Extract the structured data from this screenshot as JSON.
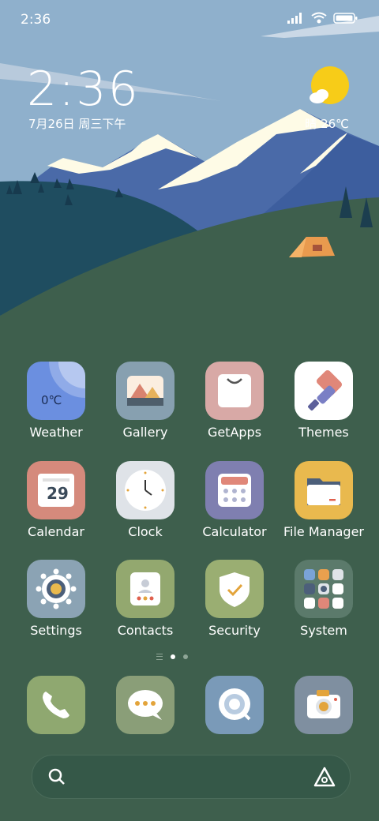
{
  "status_bar": {
    "time": "2:36"
  },
  "lockclock": {
    "time": "2:36",
    "date": "7月26日 周三下午",
    "weather": "晴 26℃"
  },
  "apps_row1": [
    {
      "label": "Weather",
      "icon_text": "0℃",
      "icon": "weather-icon",
      "color": "#6b8fe0"
    },
    {
      "label": "Gallery",
      "icon": "gallery-icon",
      "color": "#87a0b0"
    },
    {
      "label": "GetApps",
      "icon": "getapps-icon",
      "color": "#d8a9a6"
    },
    {
      "label": "Themes",
      "icon": "themes-icon",
      "color": "#ffffff"
    }
  ],
  "apps_row2": [
    {
      "label": "Calendar",
      "icon_text": "29",
      "icon": "calendar-icon",
      "color": "#d58a7c"
    },
    {
      "label": "Clock",
      "icon": "clock-icon",
      "color": "#dfe3e8"
    },
    {
      "label": "Calculator",
      "icon": "calculator-icon",
      "color": "#7f7fb0"
    },
    {
      "label": "File Manager",
      "icon": "folder-icon",
      "color": "#e9b94e"
    }
  ],
  "apps_row3": [
    {
      "label": "Settings",
      "icon": "gear-icon",
      "color": "#8ba3b4"
    },
    {
      "label": "Contacts",
      "icon": "contacts-icon",
      "color": "#93a86f"
    },
    {
      "label": "Security",
      "icon": "shield-icon",
      "color": "#9aae72"
    },
    {
      "label": "System",
      "icon": "folder-grid-icon",
      "color": "#5b7a6b"
    }
  ],
  "dock": [
    {
      "icon": "phone-icon",
      "color": "#8fa870"
    },
    {
      "icon": "messages-icon",
      "color": "#8a9e78"
    },
    {
      "icon": "browser-icon",
      "color": "#7a9ab8"
    },
    {
      "icon": "camera-icon",
      "color": "#7f8fa0"
    }
  ],
  "page_indicator": {
    "pages": 2,
    "active": 1
  }
}
